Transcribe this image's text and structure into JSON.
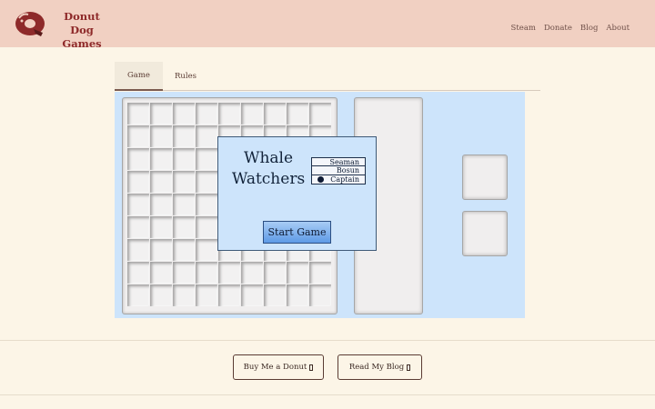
{
  "header": {
    "brand_line1": "Donut Dog",
    "brand_line2": "Games",
    "logo_icon": "donut-dog-logo-icon",
    "nav": [
      "Steam",
      "Donate",
      "Blog",
      "About"
    ]
  },
  "tabs": [
    {
      "label": "Game",
      "active": true
    },
    {
      "label": "Rules",
      "active": false
    }
  ],
  "game": {
    "grid_rows": 9,
    "grid_cols": 9,
    "modal": {
      "title_line1": "Whale",
      "title_line2": "Watchers",
      "ranks": [
        {
          "label": "Seaman",
          "selected": false
        },
        {
          "label": "Bosun",
          "selected": false
        },
        {
          "label": "Captain",
          "selected": true
        }
      ],
      "start_label": "Start Game"
    }
  },
  "footer": {
    "buttons": [
      {
        "label": "Buy Me a Donut",
        "icon": "missing-glyph-icon"
      },
      {
        "label": "Read My Blog",
        "icon": "missing-glyph-icon"
      }
    ]
  },
  "colors": {
    "header_bg": "#f1d0c2",
    "page_bg": "#fcf5e7",
    "brand": "#8e2a2a",
    "game_bg": "#cde4fb",
    "start_button": "#5e9ae6"
  }
}
